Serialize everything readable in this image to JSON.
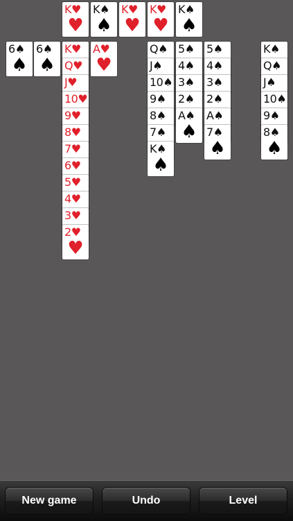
{
  "game": {
    "foundations": [
      {
        "rank": "K",
        "suit": "♥",
        "color": "red"
      },
      {
        "rank": "K",
        "suit": "♠",
        "color": "black"
      },
      {
        "rank": "K",
        "suit": "♥",
        "color": "red"
      },
      {
        "rank": "K",
        "suit": "♥",
        "color": "red"
      },
      {
        "rank": "K",
        "suit": "♠",
        "color": "black"
      }
    ],
    "columns": [
      [
        {
          "rank": "6",
          "suit": "♠",
          "color": "black"
        }
      ],
      [
        {
          "rank": "6",
          "suit": "♠",
          "color": "black"
        }
      ],
      [
        {
          "rank": "K",
          "suit": "♥",
          "color": "red"
        },
        {
          "rank": "Q",
          "suit": "♥",
          "color": "red"
        },
        {
          "rank": "J",
          "suit": "♥",
          "color": "red"
        },
        {
          "rank": "10",
          "suit": "♥",
          "color": "red"
        },
        {
          "rank": "9",
          "suit": "♥",
          "color": "red"
        },
        {
          "rank": "8",
          "suit": "♥",
          "color": "red"
        },
        {
          "rank": "7",
          "suit": "♥",
          "color": "red"
        },
        {
          "rank": "6",
          "suit": "♥",
          "color": "red"
        },
        {
          "rank": "5",
          "suit": "♥",
          "color": "red"
        },
        {
          "rank": "4",
          "suit": "♥",
          "color": "red"
        },
        {
          "rank": "3",
          "suit": "♥",
          "color": "red"
        },
        {
          "rank": "2",
          "suit": "♥",
          "color": "red"
        }
      ],
      [
        {
          "rank": "A",
          "suit": "♥",
          "color": "red"
        }
      ],
      [],
      [
        {
          "rank": "Q",
          "suit": "♠",
          "color": "black"
        },
        {
          "rank": "J",
          "suit": "♠",
          "color": "black"
        },
        {
          "rank": "10",
          "suit": "♠",
          "color": "black"
        },
        {
          "rank": "9",
          "suit": "♠",
          "color": "black"
        },
        {
          "rank": "8",
          "suit": "♠",
          "color": "black"
        },
        {
          "rank": "7",
          "suit": "♠",
          "color": "black"
        },
        {
          "rank": "K",
          "suit": "♠",
          "color": "black"
        }
      ],
      [
        {
          "rank": "5",
          "suit": "♠",
          "color": "black"
        },
        {
          "rank": "4",
          "suit": "♠",
          "color": "black"
        },
        {
          "rank": "3",
          "suit": "♠",
          "color": "black"
        },
        {
          "rank": "2",
          "suit": "♠",
          "color": "black"
        },
        {
          "rank": "A",
          "suit": "♠",
          "color": "black"
        }
      ],
      [
        {
          "rank": "5",
          "suit": "♠",
          "color": "black"
        },
        {
          "rank": "4",
          "suit": "♠",
          "color": "black"
        },
        {
          "rank": "3",
          "suit": "♠",
          "color": "black"
        },
        {
          "rank": "2",
          "suit": "♠",
          "color": "black"
        },
        {
          "rank": "A",
          "suit": "♠",
          "color": "black"
        },
        {
          "rank": "7",
          "suit": "♠",
          "color": "black"
        }
      ],
      [],
      [
        {
          "rank": "K",
          "suit": "♠",
          "color": "black"
        },
        {
          "rank": "Q",
          "suit": "♠",
          "color": "black"
        },
        {
          "rank": "J",
          "suit": "♠",
          "color": "black"
        },
        {
          "rank": "10",
          "suit": "♠",
          "color": "black"
        },
        {
          "rank": "9",
          "suit": "♠",
          "color": "black"
        },
        {
          "rank": "8",
          "suit": "♠",
          "color": "black"
        }
      ]
    ]
  },
  "toolbar": {
    "new_game_label": "New game",
    "undo_label": "Undo",
    "level_label": "Level"
  },
  "colors": {
    "table": "#5a5758",
    "red_suit": "#e0202a",
    "black_suit": "#111111"
  }
}
